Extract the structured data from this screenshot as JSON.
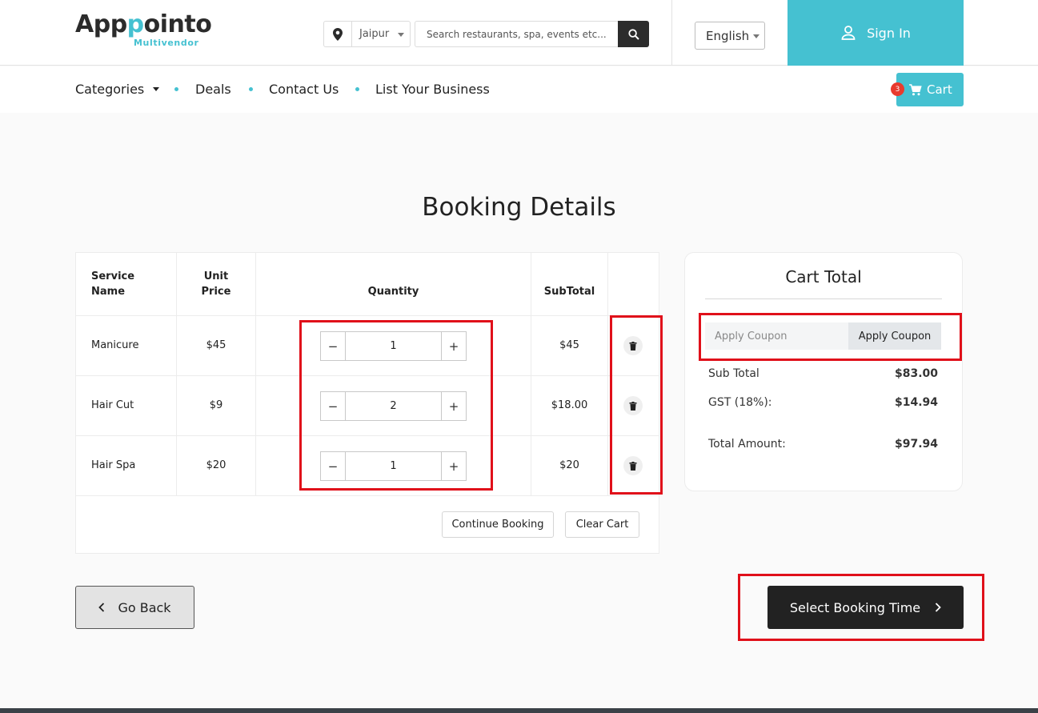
{
  "header": {
    "logo_prefix": "App",
    "logo_accent": "p",
    "logo_suffix": "ointo",
    "logo_sub": "Multivendor",
    "location": "Jaipur",
    "search_placeholder": "Search restaurants, spa, events etc...",
    "language": "English",
    "signin_label": "Sign In"
  },
  "nav": {
    "items": [
      "Categories",
      "Deals",
      "Contact Us",
      "List Your Business"
    ],
    "cart_label": "Cart",
    "cart_count": "3"
  },
  "page": {
    "title": "Booking Details"
  },
  "table": {
    "headers": {
      "service_line1": "Service",
      "service_line2": "Name",
      "price_line1": "Unit",
      "price_line2": "Price",
      "quantity": "Quantity",
      "subtotal": "SubTotal"
    },
    "rows": [
      {
        "service": "Manicure",
        "price": "$45",
        "qty": "1",
        "subtotal": "$45"
      },
      {
        "service": "Hair Cut",
        "price": "$9",
        "qty": "2",
        "subtotal": "$18.00"
      },
      {
        "service": "Hair Spa",
        "price": "$20",
        "qty": "1",
        "subtotal": "$20"
      }
    ],
    "qty_minus": "−",
    "qty_plus": "+",
    "continue_label": "Continue Booking",
    "clear_label": "Clear Cart"
  },
  "cart_total": {
    "title": "Cart Total",
    "coupon_placeholder": "Apply Coupon",
    "coupon_button": "Apply Coupon",
    "sub_total_label": "Sub Total",
    "sub_total_value": "$83.00",
    "gst_label": "GST (18%):",
    "gst_value": "$14.94",
    "total_label": "Total Amount:",
    "total_value": "$97.94"
  },
  "actions": {
    "go_back": "Go Back",
    "select_time": "Select Booking Time"
  },
  "colors": {
    "accent": "#45c1d1",
    "dark": "#222222",
    "highlight": "#e0101a",
    "badge": "#e83b2e"
  }
}
